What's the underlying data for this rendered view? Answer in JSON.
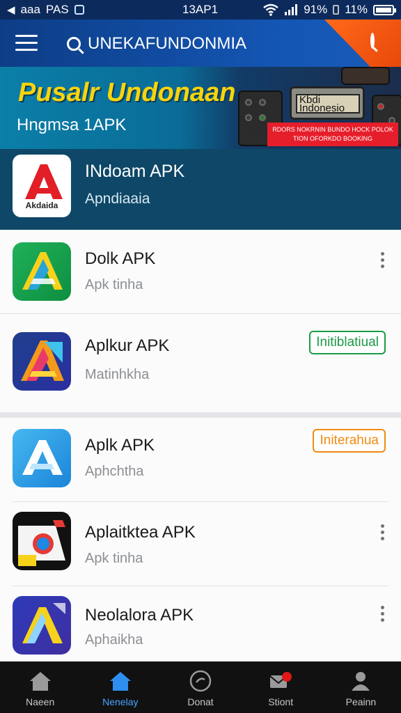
{
  "status_bar": {
    "carrier": "aaa",
    "network": "PAS",
    "time": "13AP1",
    "battery_text_1": "91%",
    "battery_text_2": "11%"
  },
  "app_bar": {
    "search_text": "UNEKAFUNDONMIA"
  },
  "banner": {
    "title": "Pusalr Undonaan",
    "subtitle": "Hngmsa 1APK",
    "panel_text": "Kbdi Indonesio",
    "strip_text": "RDORS NOKRNIN BUNDO HOCK POLOK TION OFORKDO BOOKING"
  },
  "featured": {
    "name": "INdoam APK",
    "subtitle": "Apndiaaia",
    "icon_text": "Akdaida"
  },
  "apps": [
    {
      "title": "Dolk APK",
      "subtitle": "Apk tinha",
      "action": "more"
    },
    {
      "title": "Aplkur APK",
      "subtitle": "Matinhkha",
      "action": "badge",
      "badge": "Initiblatiual",
      "badge_color": "#1a9b45"
    },
    {
      "title": "Aplk APK",
      "subtitle": "Aphchtha",
      "action": "badge",
      "badge": "Initerahua",
      "badge_color": "#f08a12"
    },
    {
      "title": "Aplaitktea APK",
      "subtitle": "Apk tinha",
      "action": "more"
    },
    {
      "title": "Neolalora APK",
      "subtitle": "Aphaikha",
      "action": "more"
    }
  ],
  "bottom_nav": [
    {
      "label": "Naeen",
      "icon": "home-icon"
    },
    {
      "label": "Nenelay",
      "icon": "home-icon"
    },
    {
      "label": "Donat",
      "icon": "download-icon"
    },
    {
      "label": "Stiont",
      "icon": "mail-icon"
    },
    {
      "label": "Peainn",
      "icon": "profile-icon"
    }
  ],
  "colors": {
    "accent": "#1456b4",
    "orange": "#ff6a1a",
    "nav_active": "#4aa3ff",
    "banner_title": "#f8d40c"
  }
}
